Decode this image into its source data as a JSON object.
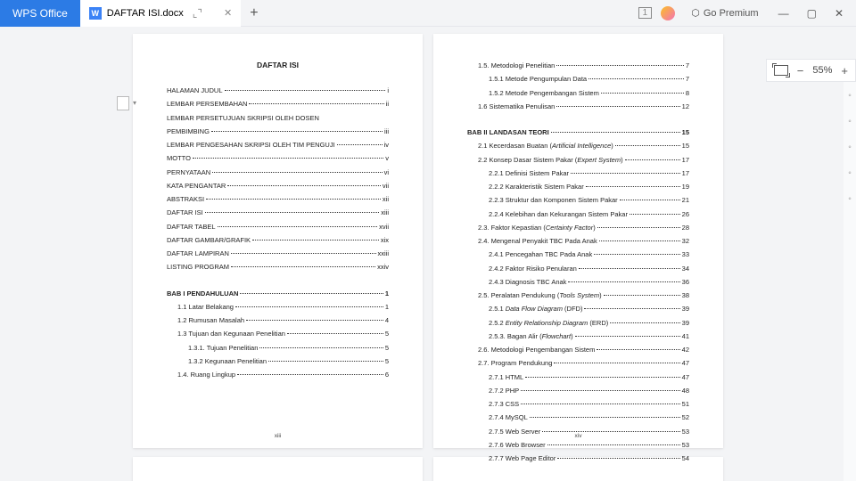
{
  "titlebar": {
    "wps_label": "WPS Office",
    "doc_title": "DAFTAR ISI.docx",
    "premium_label": "Go Premium",
    "badge": "1"
  },
  "zoom": {
    "value": "55%"
  },
  "page1": {
    "title": "DAFTAR ISI",
    "num": "xiii",
    "front": [
      {
        "t": "HALAMAN JUDUL",
        "p": "i",
        "i": 0
      },
      {
        "t": "LEMBAR PERSEMBAHAN",
        "p": "ii",
        "i": 0
      },
      {
        "t": "LEMBAR PERSETUJUAN SKRIPSI OLEH DOSEN",
        "p": "",
        "i": 0
      },
      {
        "t": "PEMBIMBING",
        "p": "iii",
        "i": 0
      },
      {
        "t": "LEMBAR PENGESAHAN SKRIPSI OLEH TIM PENGUJI",
        "p": "iv",
        "i": 0
      },
      {
        "t": "MOTTO",
        "p": "v",
        "i": 0
      },
      {
        "t": "PERNYATAAN",
        "p": "vi",
        "i": 0
      },
      {
        "t": "KATA PENGANTAR",
        "p": "vii",
        "i": 0
      },
      {
        "t": "ABSTRAKSI",
        "p": "xii",
        "i": 0
      },
      {
        "t": "DAFTAR ISI",
        "p": "xiii",
        "i": 0
      },
      {
        "t": "DAFTAR TABEL",
        "p": "xvii",
        "i": 0
      },
      {
        "t": "DAFTAR GAMBAR/GRAFIK",
        "p": "xix",
        "i": 0
      },
      {
        "t": "DAFTAR LAMPIRAN",
        "p": "xxiii",
        "i": 0
      },
      {
        "t": "LISTING PROGRAM",
        "p": "xxiv",
        "i": 0
      }
    ],
    "bab1_head": {
      "t": "BAB I PENDAHULUAN",
      "p": "1"
    },
    "bab1": [
      {
        "t": "1.1 Latar Belakang",
        "p": "1",
        "i": 1
      },
      {
        "t": "1.2 Rumusan Masalah",
        "p": "4",
        "i": 1
      },
      {
        "t": "1.3 Tujuan dan Kegunaan Penelitian",
        "p": "5",
        "i": 1
      },
      {
        "t": "1.3.1. Tujuan Penelitian",
        "p": "5",
        "i": 2
      },
      {
        "t": "1.3.2 Kegunaan Penelitian",
        "p": "5",
        "i": 2
      },
      {
        "t": "1.4. Ruang Lingkup",
        "p": "6",
        "i": 1
      }
    ]
  },
  "page2": {
    "num": "xiv",
    "top": [
      {
        "t": "1.5. Metodologi Penelitian",
        "p": "7",
        "i": 1
      },
      {
        "t": "1.5.1 Metode Pengumpulan Data",
        "p": "7",
        "i": 2
      },
      {
        "t": "1.5.2 Metode Pengembangan Sistem",
        "p": "8",
        "i": 2
      },
      {
        "t": "1.6 Sistematika Penulisan",
        "p": "12",
        "i": 1
      }
    ],
    "bab2_head": {
      "t": "BAB II LANDASAN TEORI",
      "p": "15"
    },
    "bab2": [
      {
        "t": "2.1 Kecerdasan Buatan (<em>Artificial Intelligence</em>)",
        "p": "15",
        "i": 1
      },
      {
        "t": "2.2 Konsep Dasar Sistem Pakar (<em>Expert System</em>)",
        "p": "17",
        "i": 1
      },
      {
        "t": "2.2.1 Definisi Sistem Pakar",
        "p": "17",
        "i": 2
      },
      {
        "t": "2.2.2 Karakteristik Sistem Pakar",
        "p": "19",
        "i": 2
      },
      {
        "t": "2.2.3 Struktur dan Komponen Sistem Pakar",
        "p": "21",
        "i": 2
      },
      {
        "t": "2.2.4 Kelebihan dan Kekurangan Sistem Pakar",
        "p": "26",
        "i": 2
      },
      {
        "t": "2.3. Faktor Kepastian (<em>Certainty Factor</em>)",
        "p": "28",
        "i": 1
      },
      {
        "t": "2.4. Mengenal Penyakit TBC Pada Anak",
        "p": "32",
        "i": 1
      },
      {
        "t": "2.4.1 Pencegahan TBC Pada Anak",
        "p": "33",
        "i": 2
      },
      {
        "t": "2.4.2 Faktor Risiko Penularan",
        "p": "34",
        "i": 2
      },
      {
        "t": "2.4.3 Diagnosis TBC Anak",
        "p": "36",
        "i": 2
      },
      {
        "t": "2.5. Peralatan Pendukung (<em>Tools System</em>)",
        "p": "38",
        "i": 1
      },
      {
        "t": "2.5.1 <em>Data Flow Diagram</em> (DFD)",
        "p": "39",
        "i": 2
      },
      {
        "t": "2.5.2 <em>Entity Relationship Diagram</em> (ERD)",
        "p": "39",
        "i": 2
      },
      {
        "t": "2.5.3. Bagan Alir (<em>Flowchart</em>)",
        "p": "41",
        "i": 2
      },
      {
        "t": "2.6. Metodologi Pengembangan Sistem",
        "p": "42",
        "i": 1
      },
      {
        "t": "2.7. Program Pendukung",
        "p": "47",
        "i": 1
      },
      {
        "t": "2.7.1 HTML",
        "p": "47",
        "i": 2
      },
      {
        "t": "2.7.2 PHP",
        "p": "48",
        "i": 2
      },
      {
        "t": "2.7.3 CSS",
        "p": "51",
        "i": 2
      },
      {
        "t": "2.7.4 MySQL",
        "p": "52",
        "i": 2
      },
      {
        "t": "2.7.5 Web Server",
        "p": "53",
        "i": 2
      },
      {
        "t": "2.7.6 Web Browser",
        "p": "53",
        "i": 2
      },
      {
        "t": "2.7.7 Web Page Editor",
        "p": "54",
        "i": 2
      }
    ]
  }
}
